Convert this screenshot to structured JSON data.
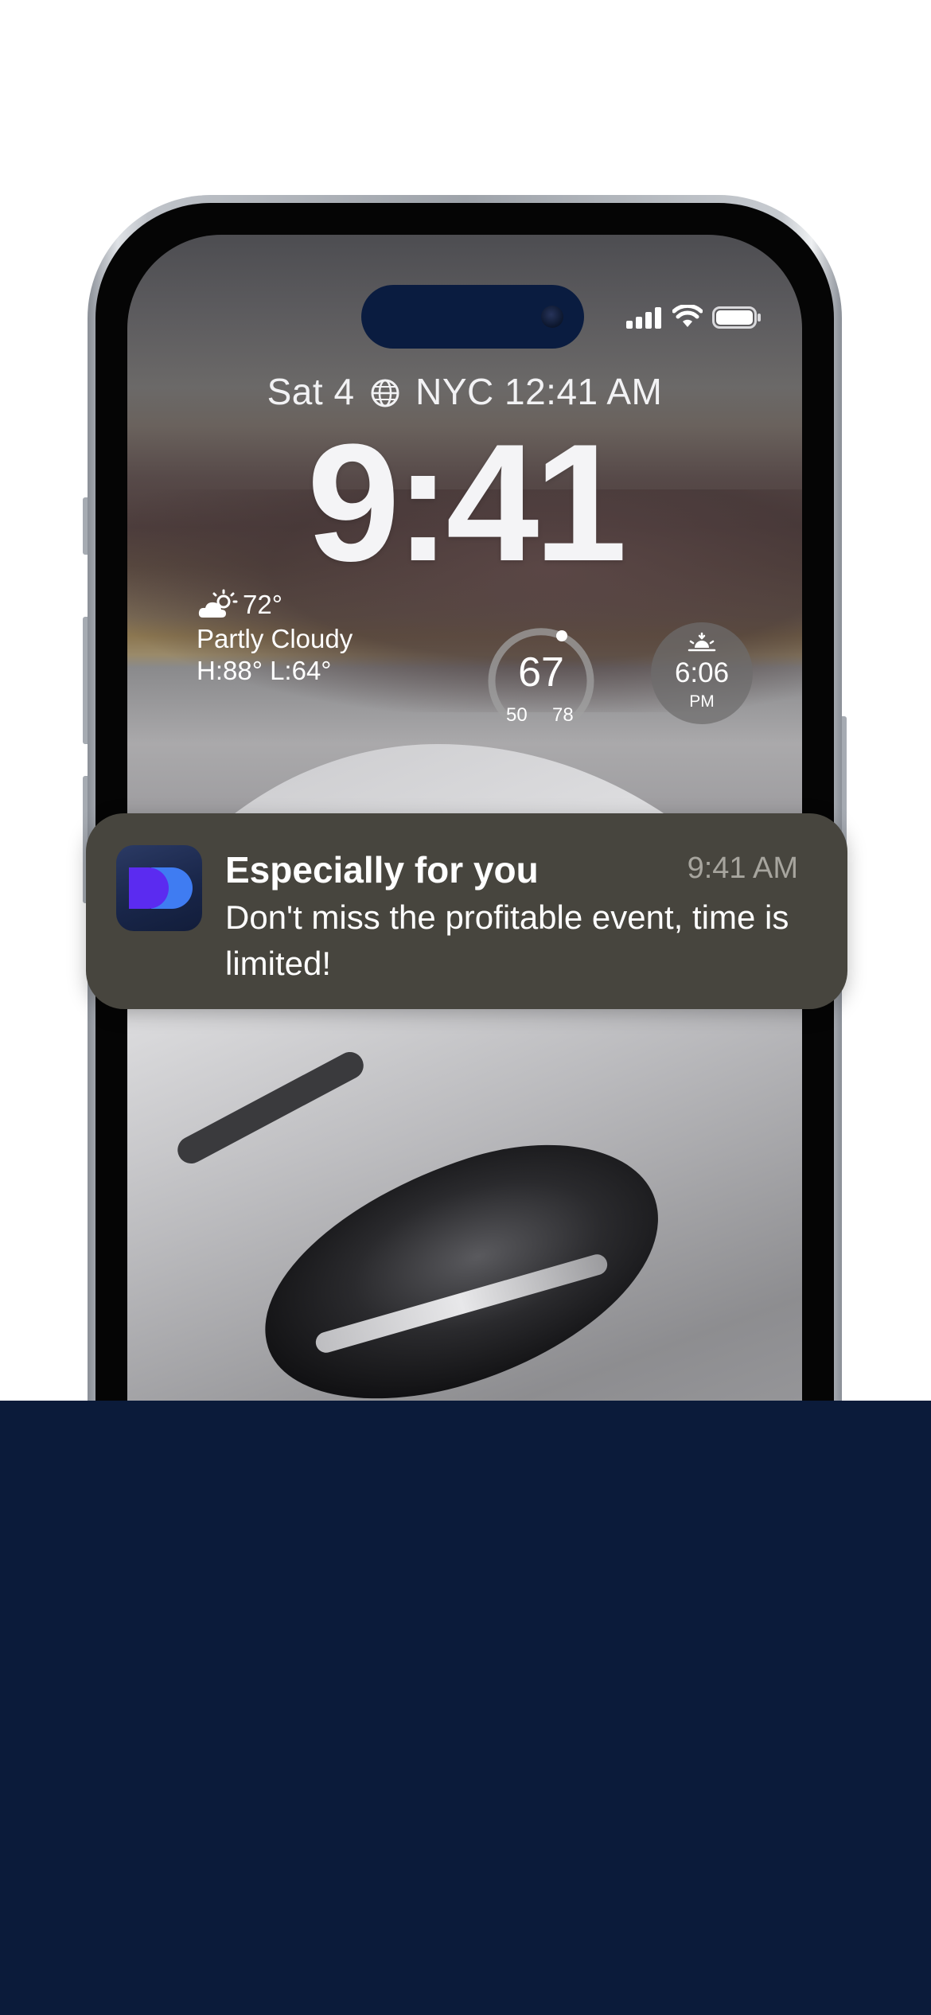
{
  "lock_screen": {
    "date_line": {
      "date": "Sat 4",
      "world_clock": "NYC 12:41 AM"
    },
    "time": "9:41",
    "widgets": {
      "weather": {
        "temperature": "72°",
        "condition": "Partly Cloudy",
        "high_low": "H:88° L:64°",
        "icon": "cloud-sun-icon"
      },
      "temperature_gauge": {
        "current": "67",
        "low": "50",
        "high": "78"
      },
      "sunset": {
        "time": "6:06",
        "period": "PM",
        "icon": "sunset-icon"
      }
    }
  },
  "status_bar": {
    "icons": [
      "signal-icon",
      "wifi-icon",
      "battery-icon"
    ]
  },
  "notification": {
    "title": "Especially for you",
    "time": "9:41 AM",
    "body": "Don't miss the profitable event, time is limited!",
    "app_icon": "app-logo-icon"
  },
  "colors": {
    "background_top": "#ffffff",
    "background_bottom": "#0b1b3a",
    "notification_bg": "#47453e",
    "dynamic_island": "#0a1c40",
    "app_logo_purple": "#5b2bf0",
    "app_logo_blue": "#3f7cf2"
  }
}
